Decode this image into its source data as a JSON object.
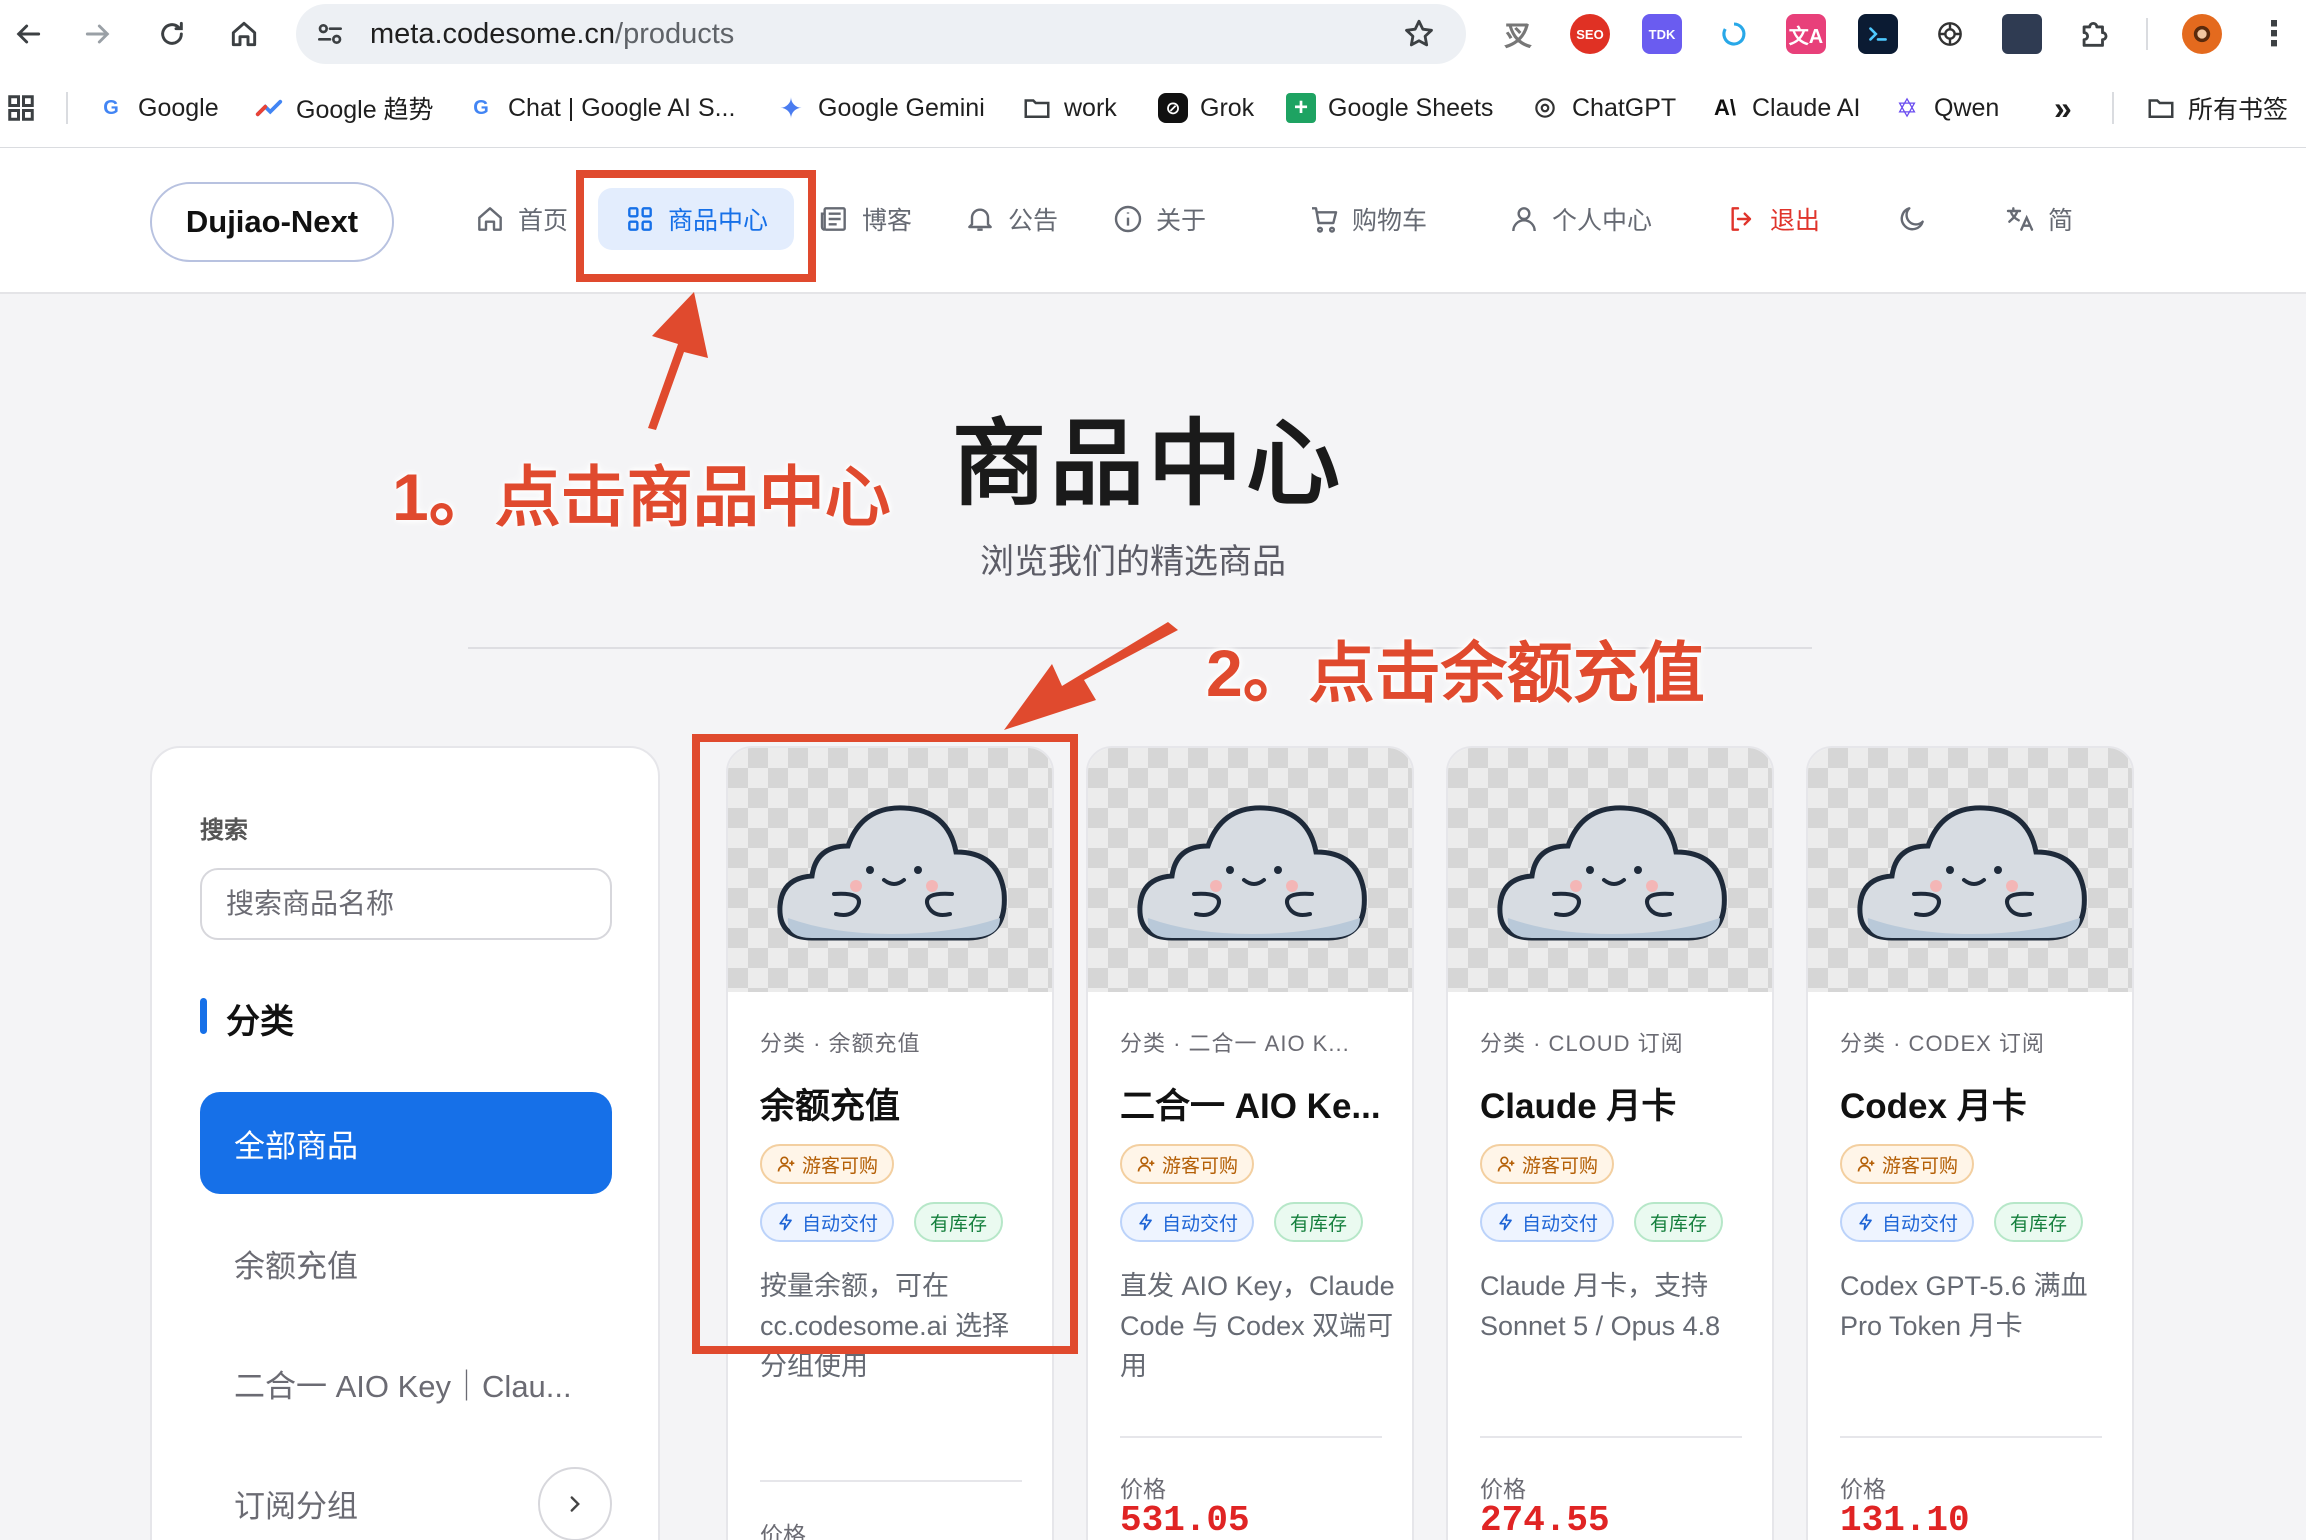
{
  "browser": {
    "url_host": "meta.codesome.cn",
    "url_path": "/products",
    "bookmarks": [
      {
        "label": "Google",
        "icon": "google-g-icon"
      },
      {
        "label": "Google 趋势",
        "icon": "trends-icon"
      },
      {
        "label": "Chat | Google AI S...",
        "icon": "google-g-icon"
      },
      {
        "label": "Google Gemini",
        "icon": "gemini-sparkle-icon"
      },
      {
        "label": "work",
        "icon": "folder-icon"
      },
      {
        "label": "Grok",
        "icon": "grok-icon"
      },
      {
        "label": "Google Sheets",
        "icon": "sheets-icon"
      },
      {
        "label": "ChatGPT",
        "icon": "openai-icon"
      },
      {
        "label": "Claude AI",
        "icon": "anthropic-icon"
      },
      {
        "label": "Qwen",
        "icon": "qwen-icon"
      }
    ],
    "more_bookmarks_glyph": "»",
    "all_bookmarks": "所有书签",
    "extensions": [
      "SEO",
      "TDK"
    ]
  },
  "site": {
    "logo": "Dujiao-Next",
    "nav": {
      "home": "首页",
      "products": "商品中心",
      "blog": "博客",
      "notice": "公告",
      "about": "关于",
      "cart": "购物车",
      "profile": "个人中心",
      "logout": "退出",
      "lang": "简"
    },
    "accent": "#1670e8"
  },
  "hero": {
    "title": "商品中心",
    "subtitle": "浏览我们的精选商品"
  },
  "sidebar": {
    "search_label": "搜索",
    "search_placeholder": "搜索商品名称",
    "category_title": "分类",
    "categories": [
      "全部商品",
      "余额充值",
      "二合一 AIO Key｜Clau...",
      "订阅分组"
    ]
  },
  "products": [
    {
      "category": "分类 · 余额充值",
      "name": "余额充值",
      "tag_guest": "游客可购",
      "tag_auto": "自动交付",
      "tag_stock": "有库存",
      "desc": "按量余额，可在 cc.codesome.ai 选择分组使用",
      "price_label": "价格",
      "price": ""
    },
    {
      "category": "分类 · 二合一 AIO K...",
      "name": "二合一 AIO Ke...",
      "tag_guest": "游客可购",
      "tag_auto": "自动交付",
      "tag_stock": "有库存",
      "desc": "直发 AIO Key，Claude Code 与 Codex 双端可用",
      "price_label": "价格",
      "price": "531.05"
    },
    {
      "category": "分类 · CLOUD 订阅",
      "name": "Claude 月卡",
      "tag_guest": "游客可购",
      "tag_auto": "自动交付",
      "tag_stock": "有库存",
      "desc": "Claude 月卡，支持 Sonnet 5 / Opus 4.8",
      "price_label": "价格",
      "price": "274.55"
    },
    {
      "category": "分类 · CODEX 订阅",
      "name": "Codex 月卡",
      "tag_guest": "游客可购",
      "tag_auto": "自动交付",
      "tag_stock": "有库存",
      "desc": "Codex GPT-5.6 满血 Pro Token 月卡",
      "price_label": "价格",
      "price": "131.10"
    }
  ],
  "annotations": {
    "step1": "1。点击商品中心",
    "step2": "2。点击余额充值",
    "color": "#e04a2e"
  }
}
